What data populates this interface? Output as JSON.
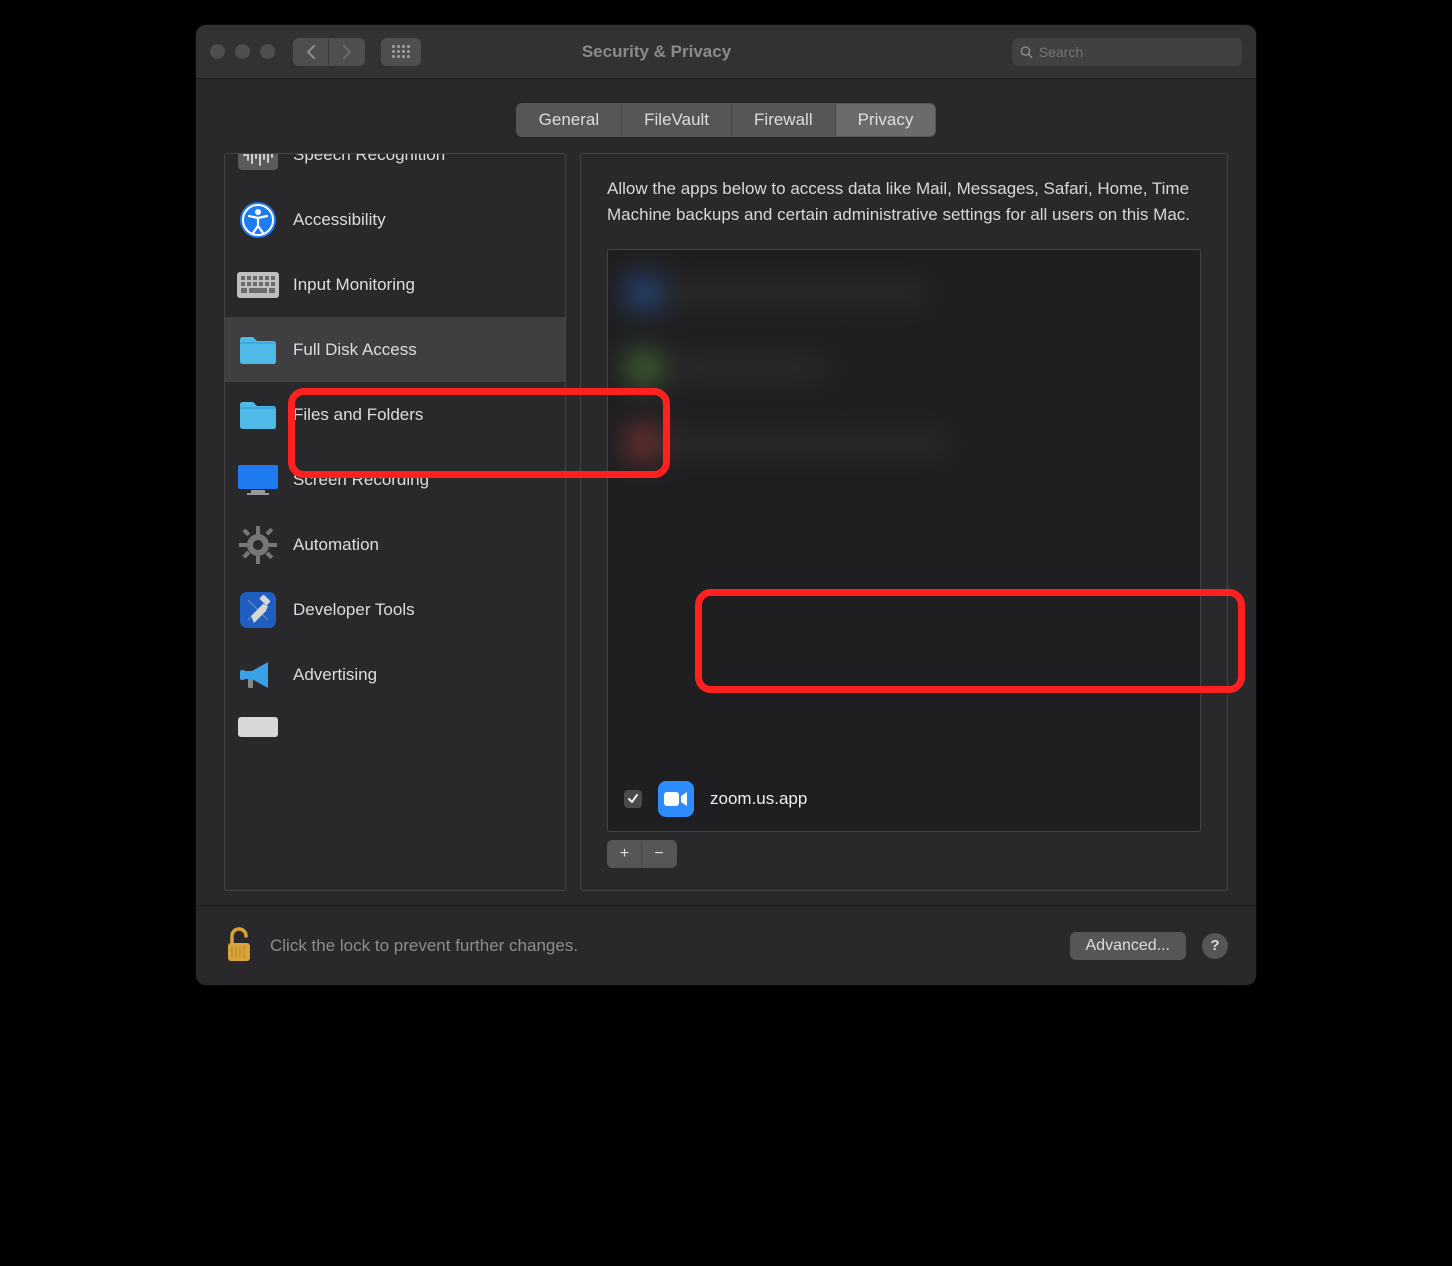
{
  "window": {
    "title": "Security & Privacy"
  },
  "search": {
    "placeholder": "Search"
  },
  "tabs": [
    {
      "label": "General"
    },
    {
      "label": "FileVault"
    },
    {
      "label": "Firewall"
    },
    {
      "label": "Privacy"
    }
  ],
  "sidebar": {
    "items": [
      {
        "label": "Speech Recognition"
      },
      {
        "label": "Accessibility"
      },
      {
        "label": "Input Monitoring"
      },
      {
        "label": "Full Disk Access"
      },
      {
        "label": "Files and Folders"
      },
      {
        "label": "Screen Recording"
      },
      {
        "label": "Automation"
      },
      {
        "label": "Developer Tools"
      },
      {
        "label": "Advertising"
      }
    ]
  },
  "detail": {
    "description": "Allow the apps below to access data like Mail, Messages, Safari, Home, Time Machine backups and certain administrative settings for all users on this Mac.",
    "app_row": {
      "name": "zoom.us.app",
      "checked": true
    },
    "add_label": "+",
    "remove_label": "−"
  },
  "footer": {
    "lock_text": "Click the lock to prevent further changes.",
    "advanced_label": "Advanced...",
    "help_label": "?"
  }
}
